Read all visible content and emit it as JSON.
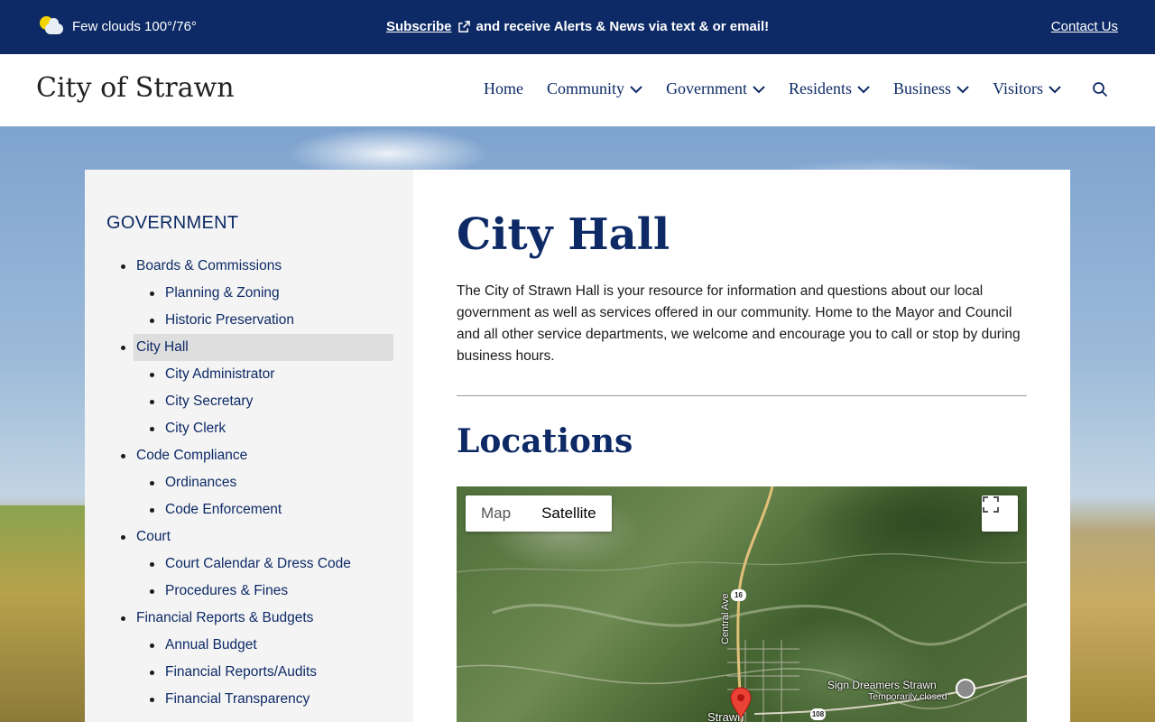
{
  "topbar": {
    "weather_text": "Few clouds 100°/76°",
    "subscribe_label": "Subscribe",
    "alert_text": "and receive Alerts & News via text & or email!",
    "contact_label": "Contact Us"
  },
  "header": {
    "site_title": "City of Strawn",
    "nav": [
      {
        "label": "Home",
        "has_dropdown": false
      },
      {
        "label": "Community",
        "has_dropdown": true
      },
      {
        "label": "Government",
        "has_dropdown": true
      },
      {
        "label": "Residents",
        "has_dropdown": true
      },
      {
        "label": "Business",
        "has_dropdown": true
      },
      {
        "label": "Visitors",
        "has_dropdown": true
      }
    ]
  },
  "sidebar": {
    "title": "GOVERNMENT",
    "items": [
      {
        "label": "Boards & Commissions",
        "level": 1
      },
      {
        "label": "Planning & Zoning",
        "level": 2
      },
      {
        "label": "Historic Preservation",
        "level": 2
      },
      {
        "label": "City Hall",
        "level": 1,
        "active": true
      },
      {
        "label": "City Administrator",
        "level": 2
      },
      {
        "label": "City Secretary",
        "level": 2
      },
      {
        "label": "City Clerk",
        "level": 2
      },
      {
        "label": "Code Compliance",
        "level": 1
      },
      {
        "label": "Ordinances",
        "level": 2
      },
      {
        "label": "Code Enforcement",
        "level": 2
      },
      {
        "label": "Court",
        "level": 1
      },
      {
        "label": "Court Calendar & Dress Code",
        "level": 2
      },
      {
        "label": "Procedures & Fines",
        "level": 2
      },
      {
        "label": "Financial Reports & Budgets",
        "level": 1
      },
      {
        "label": "Annual Budget",
        "level": 2
      },
      {
        "label": "Financial Reports/Audits",
        "level": 2
      },
      {
        "label": "Financial Transparency",
        "level": 2
      }
    ]
  },
  "main": {
    "page_title": "City Hall",
    "intro": "The City of Strawn Hall is your resource for information and questions about our local government as well as services offered in our community. Home to the Mayor and Council and all other service departments, we welcome and encourage you to call or stop by during business hours.",
    "section_title": "Locations"
  },
  "map": {
    "type_map_label": "Map",
    "type_satellite_label": "Satellite",
    "selected_type": "Satellite",
    "road_label": "Central Ave",
    "route_16": "16",
    "route_108": "108",
    "poi_name": "Sign Dreamers Strawn",
    "poi_status": "Temporarily closed",
    "town_label": "Strawn"
  },
  "colors": {
    "brand_navy": "#0d2a66",
    "sidebar_bg": "#f4f4f4",
    "active_item_bg": "#dedede",
    "pin_red": "#ea4335"
  }
}
